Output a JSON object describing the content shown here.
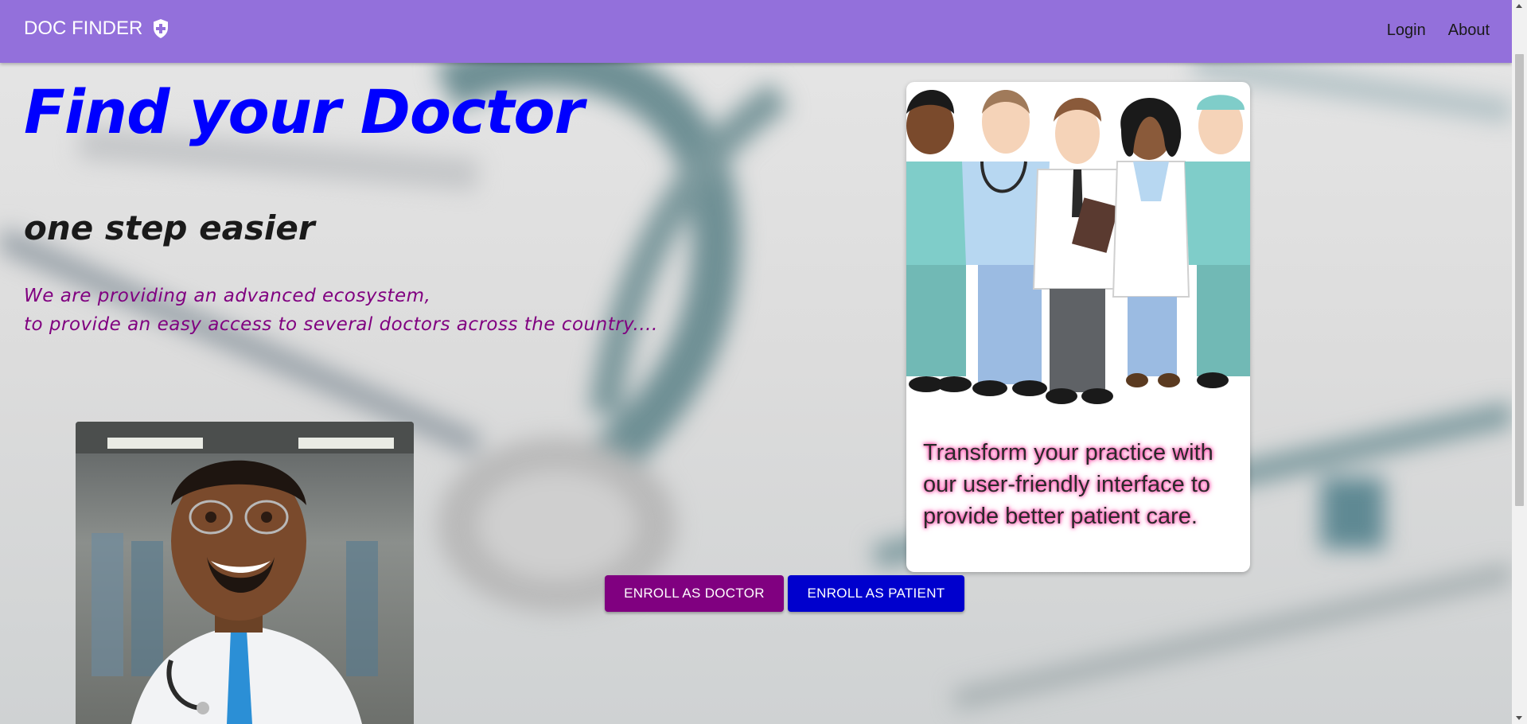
{
  "appbar": {
    "brand": "DOC FINDER",
    "brand_icon": "shield-plus-icon",
    "background": "#9370db",
    "nav": [
      {
        "label": "Login"
      },
      {
        "label": "About"
      }
    ]
  },
  "hero": {
    "title": "Find your Doctor",
    "subtitle": "one step easier",
    "description_line1": "We are providing an advanced ecosystem,",
    "description_line2": "to provide an easy access to several doctors across the country....",
    "title_color": "#0000ff",
    "description_color": "#800080"
  },
  "card": {
    "image": "doctors-group-illustration",
    "text": "Transform your practice with our user-friendly interface to provide better patient care."
  },
  "buttons": {
    "enroll_doctor": "ENROLL AS DOCTOR",
    "enroll_patient": "ENROLL AS PATIENT",
    "doctor_color": "#800080",
    "patient_color": "#0000cd"
  },
  "images": {
    "doctor_portrait": "cartoon-doctor-portrait",
    "background": "stethoscope-background"
  }
}
